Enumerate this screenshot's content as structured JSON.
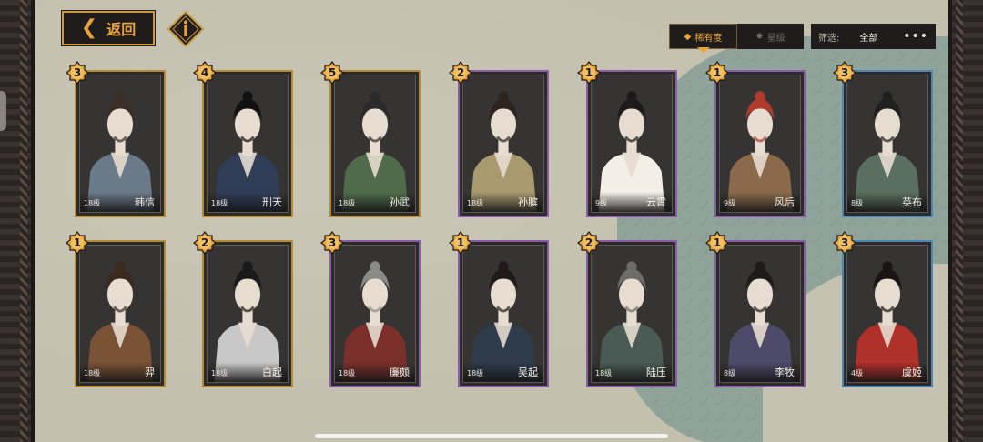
{
  "header": {
    "back_label": "返回",
    "info_icon": "info-icon"
  },
  "sort": {
    "options": [
      {
        "label": "稀有度",
        "active": true
      },
      {
        "label": "星级",
        "active": false
      }
    ]
  },
  "filter": {
    "label": "筛选:",
    "value": "全部",
    "more": "•••"
  },
  "colors": {
    "gold": "#e9a437",
    "frame_gold": "#b58a36",
    "frame_purple": "#8b5da8",
    "frame_blue": "#4f86b4",
    "panel": "#1f1c1b"
  },
  "cards": [
    {
      "name": "韩信",
      "level": "18级",
      "rank": "3",
      "frame": "gold",
      "robe": "#6b7a88",
      "hair": "#3a2e26"
    },
    {
      "name": "刑天",
      "level": "18级",
      "rank": "4",
      "frame": "gold",
      "robe": "#2f3d57",
      "hair": "#111111"
    },
    {
      "name": "孙武",
      "level": "18级",
      "rank": "5",
      "frame": "gold",
      "robe": "#4f6b4a",
      "hair": "#2a2a2a"
    },
    {
      "name": "孙膑",
      "level": "18级",
      "rank": "2",
      "frame": "purple",
      "robe": "#a89a6e",
      "hair": "#2b2420"
    },
    {
      "name": "云霄",
      "level": "9级",
      "rank": "1",
      "frame": "purple",
      "robe": "#f3efe6",
      "hair": "#1c1a1a"
    },
    {
      "name": "风后",
      "level": "9级",
      "rank": "1",
      "frame": "purple",
      "robe": "#8a6a4a",
      "hair": "#b13a2c"
    },
    {
      "name": "英布",
      "level": "8级",
      "rank": "3",
      "frame": "blue",
      "robe": "#5a6f5f",
      "hair": "#1f2020"
    },
    {
      "name": "羿",
      "level": "18级",
      "rank": "1",
      "frame": "gold",
      "robe": "#7a5236",
      "hair": "#3a2a1e"
    },
    {
      "name": "白起",
      "level": "18级",
      "rank": "2",
      "frame": "gold",
      "robe": "#c8c8c8",
      "hair": "#1a1a1a"
    },
    {
      "name": "廉颇",
      "level": "18级",
      "rank": "3",
      "frame": "purple",
      "robe": "#7a2f2a",
      "hair": "#8a8a86"
    },
    {
      "name": "吴起",
      "level": "18级",
      "rank": "1",
      "frame": "purple",
      "robe": "#2e3b4a",
      "hair": "#1f1a18"
    },
    {
      "name": "陆压",
      "level": "18级",
      "rank": "2",
      "frame": "purple",
      "robe": "#4a5a55",
      "hair": "#6d6d6a"
    },
    {
      "name": "李牧",
      "level": "8级",
      "rank": "1",
      "frame": "purple",
      "robe": "#4e4a6a",
      "hair": "#1e1b1a"
    },
    {
      "name": "虞姬",
      "level": "4级",
      "rank": "3",
      "frame": "blue",
      "robe": "#b0302a",
      "hair": "#1a1414"
    }
  ]
}
